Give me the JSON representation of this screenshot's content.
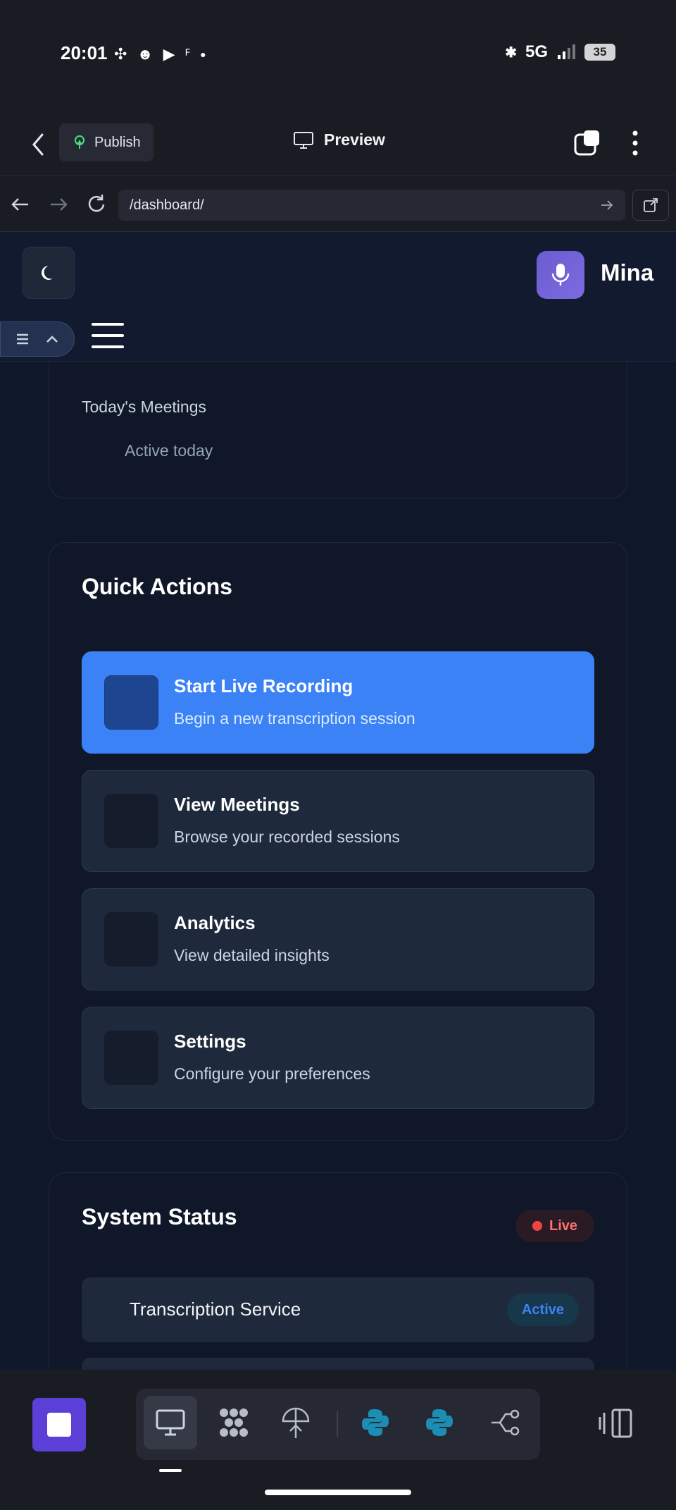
{
  "status_bar": {
    "time": "20:01",
    "network": "5G",
    "battery": "35"
  },
  "appbar": {
    "publish_label": "Publish",
    "preview_label": "Preview"
  },
  "browser": {
    "url": "/dashboard/"
  },
  "header": {
    "brand_name": "Mina"
  },
  "stats": {
    "label": "Today's Meetings",
    "sub": "Active today"
  },
  "quick_actions": {
    "title": "Quick Actions",
    "items": [
      {
        "title": "Start Live Recording",
        "desc": "Begin a new transcription session"
      },
      {
        "title": "View Meetings",
        "desc": "Browse your recorded sessions"
      },
      {
        "title": "Analytics",
        "desc": "View detailed insights"
      },
      {
        "title": "Settings",
        "desc": "Configure your preferences"
      }
    ]
  },
  "system_status": {
    "title": "System Status",
    "live_label": "Live",
    "rows": [
      {
        "name": "Transcription Service",
        "status": "Active"
      }
    ]
  },
  "colors": {
    "accent": "#3b82f6",
    "brand": "#6d5bd0",
    "live": "#ef4444",
    "python": "#1b8fb3"
  }
}
